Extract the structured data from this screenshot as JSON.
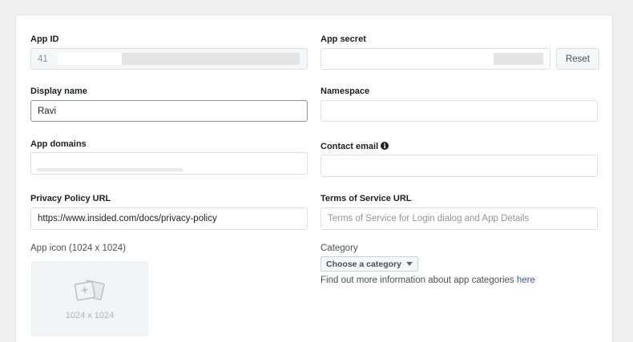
{
  "app_id": {
    "label": "App ID",
    "value_prefix": "41"
  },
  "app_secret": {
    "label": "App secret",
    "reset_label": "Reset"
  },
  "display_name": {
    "label": "Display name",
    "value": "Ravi"
  },
  "namespace": {
    "label": "Namespace",
    "value": ""
  },
  "app_domains": {
    "label": "App domains"
  },
  "contact_email": {
    "label": "Contact email",
    "info_glyph": "i"
  },
  "privacy_policy": {
    "label": "Privacy Policy URL",
    "value": "https://www.insided.com/docs/privacy-policy"
  },
  "terms_of_service": {
    "label": "Terms of Service URL",
    "placeholder": "Terms of Service for Login dialog and App Details"
  },
  "app_icon": {
    "label": "App icon (1024 x 1024)",
    "dimensions": "1024 x 1024",
    "icon": "image-add-icon"
  },
  "category": {
    "label": "Category",
    "selected": "Choose a category",
    "help_text": "Find out more information about app categories ",
    "help_link": "here"
  },
  "colors": {
    "link": "#385898",
    "page_bg": "#f0f0f0",
    "card_bg": "#ffffff"
  }
}
